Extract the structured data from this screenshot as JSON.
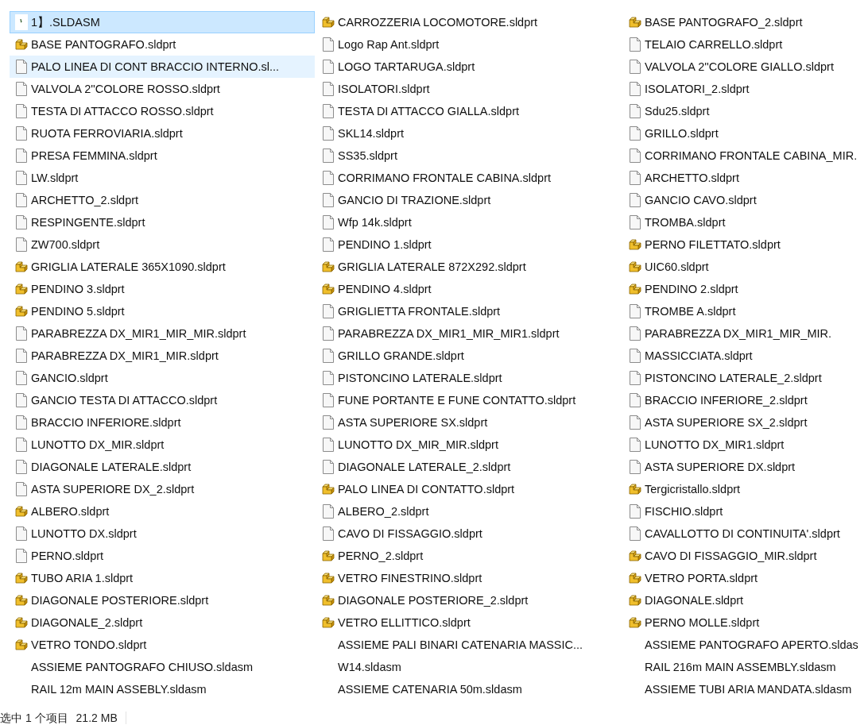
{
  "files": [
    {
      "name": "1】.SLDASM",
      "kind": "thumbnail",
      "selected": true,
      "hovered": false
    },
    {
      "name": "BASE PANTOGRAFO.sldprt",
      "kind": "part",
      "selected": false,
      "hovered": false
    },
    {
      "name": "PALO LINEA DI CONT BRACCIO INTERNO.sl...",
      "kind": "file",
      "selected": false,
      "hovered": true
    },
    {
      "name": "VALVOLA 2''COLORE ROSSO.sldprt",
      "kind": "file",
      "selected": false,
      "hovered": false
    },
    {
      "name": "TESTA DI ATTACCO ROSSO.sldprt",
      "kind": "file",
      "selected": false,
      "hovered": false
    },
    {
      "name": "RUOTA FERROVIARIA.sldprt",
      "kind": "file",
      "selected": false,
      "hovered": false
    },
    {
      "name": "PRESA FEMMINA.sldprt",
      "kind": "file",
      "selected": false,
      "hovered": false
    },
    {
      "name": "LW.sldprt",
      "kind": "file",
      "selected": false,
      "hovered": false
    },
    {
      "name": "ARCHETTO_2.sldprt",
      "kind": "file",
      "selected": false,
      "hovered": false
    },
    {
      "name": "RESPINGENTE.sldprt",
      "kind": "file",
      "selected": false,
      "hovered": false
    },
    {
      "name": "ZW700.sldprt",
      "kind": "file",
      "selected": false,
      "hovered": false
    },
    {
      "name": "GRIGLIA LATERALE 365X1090.sldprt",
      "kind": "part",
      "selected": false,
      "hovered": false
    },
    {
      "name": "PENDINO 3.sldprt",
      "kind": "part",
      "selected": false,
      "hovered": false
    },
    {
      "name": "PENDINO 5.sldprt",
      "kind": "part",
      "selected": false,
      "hovered": false
    },
    {
      "name": "PARABREZZA DX_MIR1_MIR_MIR.sldprt",
      "kind": "file",
      "selected": false,
      "hovered": false
    },
    {
      "name": "PARABREZZA DX_MIR1_MIR.sldprt",
      "kind": "file",
      "selected": false,
      "hovered": false
    },
    {
      "name": "GANCIO.sldprt",
      "kind": "file",
      "selected": false,
      "hovered": false
    },
    {
      "name": "GANCIO TESTA DI ATTACCO.sldprt",
      "kind": "file",
      "selected": false,
      "hovered": false
    },
    {
      "name": "BRACCIO INFERIORE.sldprt",
      "kind": "file",
      "selected": false,
      "hovered": false
    },
    {
      "name": "LUNOTTO DX_MIR.sldprt",
      "kind": "file",
      "selected": false,
      "hovered": false
    },
    {
      "name": "DIAGONALE LATERALE.sldprt",
      "kind": "file",
      "selected": false,
      "hovered": false
    },
    {
      "name": "ASTA SUPERIORE DX_2.sldprt",
      "kind": "file",
      "selected": false,
      "hovered": false
    },
    {
      "name": "ALBERO.sldprt",
      "kind": "part",
      "selected": false,
      "hovered": false
    },
    {
      "name": "LUNOTTO DX.sldprt",
      "kind": "file",
      "selected": false,
      "hovered": false
    },
    {
      "name": "PERNO.sldprt",
      "kind": "file",
      "selected": false,
      "hovered": false
    },
    {
      "name": "TUBO ARIA 1.sldprt",
      "kind": "part",
      "selected": false,
      "hovered": false
    },
    {
      "name": "DIAGONALE POSTERIORE.sldprt",
      "kind": "part",
      "selected": false,
      "hovered": false
    },
    {
      "name": "DIAGONALE_2.sldprt",
      "kind": "part",
      "selected": false,
      "hovered": false
    },
    {
      "name": "VETRO TONDO.sldprt",
      "kind": "part",
      "selected": false,
      "hovered": false
    },
    {
      "name": "ASSIEME PANTOGRAFO CHIUSO.sldasm",
      "kind": "none",
      "selected": false,
      "hovered": false
    },
    {
      "name": "RAIL 12m MAIN ASSEBLY.sldasm",
      "kind": "none",
      "selected": false,
      "hovered": false
    },
    {
      "name": "CARROZZERIA LOCOMOTORE.sldprt",
      "kind": "part",
      "selected": false,
      "hovered": false
    },
    {
      "name": "Logo Rap Ant.sldprt",
      "kind": "file",
      "selected": false,
      "hovered": false
    },
    {
      "name": "LOGO TARTARUGA.sldprt",
      "kind": "file",
      "selected": false,
      "hovered": false
    },
    {
      "name": "ISOLATORI.sldprt",
      "kind": "file",
      "selected": false,
      "hovered": false
    },
    {
      "name": "TESTA DI ATTACCO GIALLA.sldprt",
      "kind": "file",
      "selected": false,
      "hovered": false
    },
    {
      "name": "SKL14.sldprt",
      "kind": "file",
      "selected": false,
      "hovered": false
    },
    {
      "name": "SS35.sldprt",
      "kind": "file",
      "selected": false,
      "hovered": false
    },
    {
      "name": "CORRIMANO FRONTALE CABINA.sldprt",
      "kind": "file",
      "selected": false,
      "hovered": false
    },
    {
      "name": "GANCIO DI TRAZIONE.sldprt",
      "kind": "file",
      "selected": false,
      "hovered": false
    },
    {
      "name": "Wfp 14k.sldprt",
      "kind": "file",
      "selected": false,
      "hovered": false
    },
    {
      "name": "PENDINO 1.sldprt",
      "kind": "file",
      "selected": false,
      "hovered": false
    },
    {
      "name": "GRIGLIA LATERALE 872X292.sldprt",
      "kind": "part",
      "selected": false,
      "hovered": false
    },
    {
      "name": "PENDINO 4.sldprt",
      "kind": "part",
      "selected": false,
      "hovered": false
    },
    {
      "name": "GRIGLIETTA FRONTALE.sldprt",
      "kind": "file",
      "selected": false,
      "hovered": false
    },
    {
      "name": "PARABREZZA DX_MIR1_MIR_MIR1.sldprt",
      "kind": "file",
      "selected": false,
      "hovered": false
    },
    {
      "name": "GRILLO GRANDE.sldprt",
      "kind": "file",
      "selected": false,
      "hovered": false
    },
    {
      "name": "PISTONCINO LATERALE.sldprt",
      "kind": "file",
      "selected": false,
      "hovered": false
    },
    {
      "name": "FUNE PORTANTE E FUNE CONTATTO.sldprt",
      "kind": "file",
      "selected": false,
      "hovered": false
    },
    {
      "name": "ASTA SUPERIORE SX.sldprt",
      "kind": "file",
      "selected": false,
      "hovered": false
    },
    {
      "name": "LUNOTTO DX_MIR_MIR.sldprt",
      "kind": "file",
      "selected": false,
      "hovered": false
    },
    {
      "name": "DIAGONALE LATERALE_2.sldprt",
      "kind": "file",
      "selected": false,
      "hovered": false
    },
    {
      "name": "PALO LINEA DI CONTATTO.sldprt",
      "kind": "part",
      "selected": false,
      "hovered": false
    },
    {
      "name": "ALBERO_2.sldprt",
      "kind": "file",
      "selected": false,
      "hovered": false
    },
    {
      "name": "CAVO DI FISSAGGIO.sldprt",
      "kind": "file",
      "selected": false,
      "hovered": false
    },
    {
      "name": "PERNO_2.sldprt",
      "kind": "part",
      "selected": false,
      "hovered": false
    },
    {
      "name": "VETRO FINESTRINO.sldprt",
      "kind": "part",
      "selected": false,
      "hovered": false
    },
    {
      "name": "DIAGONALE POSTERIORE_2.sldprt",
      "kind": "part",
      "selected": false,
      "hovered": false
    },
    {
      "name": "VETRO ELLITTICO.sldprt",
      "kind": "part",
      "selected": false,
      "hovered": false
    },
    {
      "name": "ASSIEME PALI BINARI CATENARIA MASSIC...",
      "kind": "none",
      "selected": false,
      "hovered": false
    },
    {
      "name": "W14.sldasm",
      "kind": "none",
      "selected": false,
      "hovered": false
    },
    {
      "name": "ASSIEME CATENARIA 50m.sldasm",
      "kind": "none",
      "selected": false,
      "hovered": false
    },
    {
      "name": "BASE PANTOGRAFO_2.sldprt",
      "kind": "part",
      "selected": false,
      "hovered": false
    },
    {
      "name": "TELAIO CARRELLO.sldprt",
      "kind": "file",
      "selected": false,
      "hovered": false
    },
    {
      "name": "VALVOLA 2''COLORE GIALLO.sldprt",
      "kind": "file",
      "selected": false,
      "hovered": false
    },
    {
      "name": "ISOLATORI_2.sldprt",
      "kind": "file",
      "selected": false,
      "hovered": false
    },
    {
      "name": "Sdu25.sldprt",
      "kind": "file",
      "selected": false,
      "hovered": false
    },
    {
      "name": "GRILLO.sldprt",
      "kind": "file",
      "selected": false,
      "hovered": false
    },
    {
      "name": "CORRIMANO FRONTALE CABINA_MIR.",
      "kind": "file",
      "selected": false,
      "hovered": false
    },
    {
      "name": "ARCHETTO.sldprt",
      "kind": "file",
      "selected": false,
      "hovered": false
    },
    {
      "name": "GANCIO CAVO.sldprt",
      "kind": "file",
      "selected": false,
      "hovered": false
    },
    {
      "name": "TROMBA.sldprt",
      "kind": "file",
      "selected": false,
      "hovered": false
    },
    {
      "name": "PERNO FILETTATO.sldprt",
      "kind": "part",
      "selected": false,
      "hovered": false
    },
    {
      "name": "UIC60.sldprt",
      "kind": "part",
      "selected": false,
      "hovered": false
    },
    {
      "name": "PENDINO 2.sldprt",
      "kind": "part",
      "selected": false,
      "hovered": false
    },
    {
      "name": "TROMBE A.sldprt",
      "kind": "file",
      "selected": false,
      "hovered": false
    },
    {
      "name": "PARABREZZA DX_MIR1_MIR_MIR.",
      "kind": "file",
      "selected": false,
      "hovered": false
    },
    {
      "name": "MASSICCIATA.sldprt",
      "kind": "file",
      "selected": false,
      "hovered": false
    },
    {
      "name": "PISTONCINO LATERALE_2.sldprt",
      "kind": "file",
      "selected": false,
      "hovered": false
    },
    {
      "name": "BRACCIO INFERIORE_2.sldprt",
      "kind": "file",
      "selected": false,
      "hovered": false
    },
    {
      "name": "ASTA SUPERIORE SX_2.sldprt",
      "kind": "file",
      "selected": false,
      "hovered": false
    },
    {
      "name": "LUNOTTO DX_MIR1.sldprt",
      "kind": "file",
      "selected": false,
      "hovered": false
    },
    {
      "name": "ASTA SUPERIORE DX.sldprt",
      "kind": "file",
      "selected": false,
      "hovered": false
    },
    {
      "name": "Tergicristallo.sldprt",
      "kind": "part",
      "selected": false,
      "hovered": false
    },
    {
      "name": "FISCHIO.sldprt",
      "kind": "file",
      "selected": false,
      "hovered": false
    },
    {
      "name": "CAVALLOTTO DI CONTINUITA'.sldprt",
      "kind": "file",
      "selected": false,
      "hovered": false
    },
    {
      "name": "CAVO DI FISSAGGIO_MIR.sldprt",
      "kind": "part",
      "selected": false,
      "hovered": false
    },
    {
      "name": "VETRO PORTA.sldprt",
      "kind": "part",
      "selected": false,
      "hovered": false
    },
    {
      "name": "DIAGONALE.sldprt",
      "kind": "part",
      "selected": false,
      "hovered": false
    },
    {
      "name": "PERNO MOLLE.sldprt",
      "kind": "part",
      "selected": false,
      "hovered": false
    },
    {
      "name": "ASSIEME PANTOGRAFO APERTO.sldas",
      "kind": "none",
      "selected": false,
      "hovered": false
    },
    {
      "name": "RAIL 216m MAIN ASSEMBLY.sldasm",
      "kind": "none",
      "selected": false,
      "hovered": false
    },
    {
      "name": "ASSIEME TUBI ARIA MANDATA.sldasm",
      "kind": "none",
      "selected": false,
      "hovered": false
    }
  ],
  "status_bar": {
    "selection": "选中 1 个项目",
    "size": "21.2 MB"
  }
}
